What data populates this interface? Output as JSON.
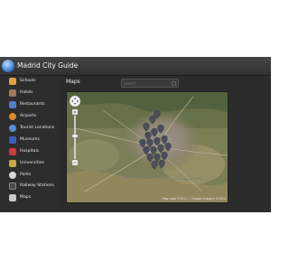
{
  "app": {
    "title": "Madrid City Guide"
  },
  "sidebar": {
    "items": [
      {
        "label": "Schools",
        "icon": "school-icon",
        "color": "#e0a23a"
      },
      {
        "label": "Hotels",
        "icon": "hotel-icon",
        "color": "#9a7a5a"
      },
      {
        "label": "Restaurants",
        "icon": "restaurant-icon",
        "color": "#4f7dc9"
      },
      {
        "label": "Airports",
        "icon": "airport-icon",
        "color": "#e08a28"
      },
      {
        "label": "Tourist Locations",
        "icon": "tourist-icon",
        "color": "#5a8fd0"
      },
      {
        "label": "Museums",
        "icon": "museum-icon",
        "color": "#3a5fb8"
      },
      {
        "label": "Hospitals",
        "icon": "hospital-icon",
        "color": "#d23a3a"
      },
      {
        "label": "Universities",
        "icon": "university-icon",
        "color": "#c8a64a"
      },
      {
        "label": "Parks",
        "icon": "park-icon",
        "color": "#d8d8d8"
      },
      {
        "label": "Railway Stations",
        "icon": "railway-icon",
        "color": "#4a4a4a"
      },
      {
        "label": "Maps",
        "icon": "maps-icon",
        "color": "#c9c9c9"
      }
    ]
  },
  "main": {
    "title": "Maps",
    "search": {
      "placeholder": "Search",
      "icon": "search-icon"
    },
    "map": {
      "attribution": "Map data ©2011 ... Google Imagery ©2011"
    }
  },
  "colors": {
    "background": "#2b2b2b",
    "titlebar": "#3c3c3c",
    "marker": "#4a4e57"
  }
}
